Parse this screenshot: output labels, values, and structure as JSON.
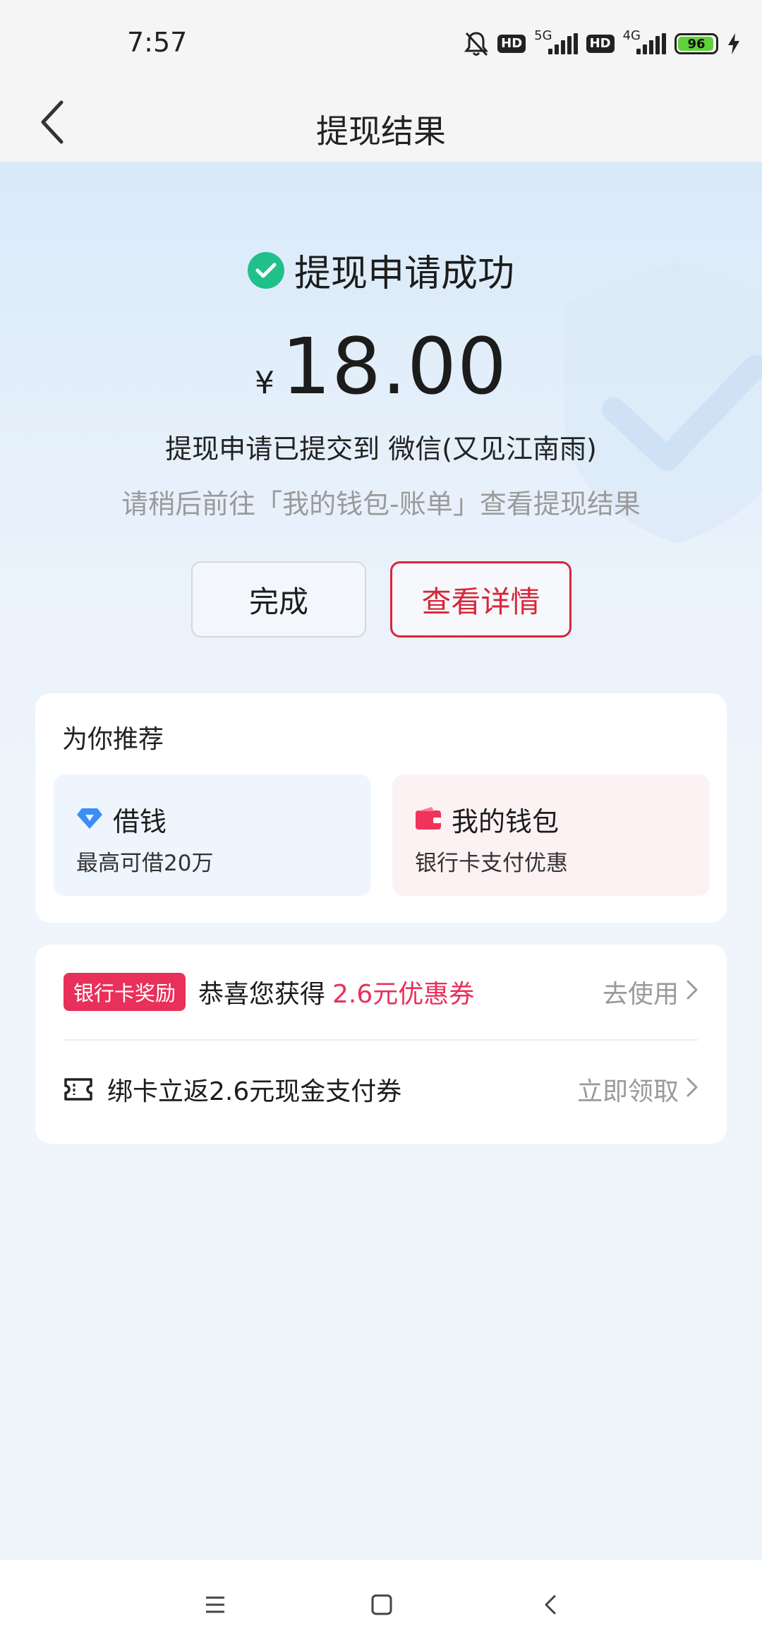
{
  "status_bar": {
    "time": "7:57",
    "hd_label": "HD",
    "net1": "5G",
    "net2": "4G",
    "battery": "96",
    "battery_level": 0.96,
    "icons": [
      "bell-muted-icon",
      "hd-icon",
      "signal-5g-icon",
      "hd-icon",
      "signal-4g-icon",
      "battery-icon",
      "charging-icon"
    ]
  },
  "header": {
    "title": "提现结果",
    "back_icon": "chevron-left-icon"
  },
  "result": {
    "success_text": "提现申请成功",
    "currency": "¥",
    "amount": "18.00",
    "submitted_text": "提现申请已提交到 微信(又见江南雨)",
    "hint_text": "请稍后前往「我的钱包-账单」查看提现结果",
    "done_label": "完成",
    "detail_label": "查看详情"
  },
  "recommend": {
    "title": "为你推荐",
    "items": [
      {
        "title": "借钱",
        "subtitle": "最高可借20万",
        "icon": "diamond-icon"
      },
      {
        "title": "我的钱包",
        "subtitle": "银行卡支付优惠",
        "icon": "wallet-icon"
      }
    ]
  },
  "offers": {
    "items": [
      {
        "badge": "银行卡奖励",
        "text": "恭喜您获得",
        "highlight": "2.6元优惠券",
        "action": "去使用"
      },
      {
        "icon": "ticket-icon",
        "text": "绑卡立返2.6元现金支付券",
        "action": "立即领取"
      }
    ]
  },
  "colors": {
    "accent_red": "#d8263a",
    "success_green": "#20c08a",
    "badge_pink": "#e8305a",
    "loan_blue": "#3a8ef6"
  },
  "nav": {
    "icons": [
      "menu-icon",
      "home-icon",
      "back-icon"
    ]
  }
}
